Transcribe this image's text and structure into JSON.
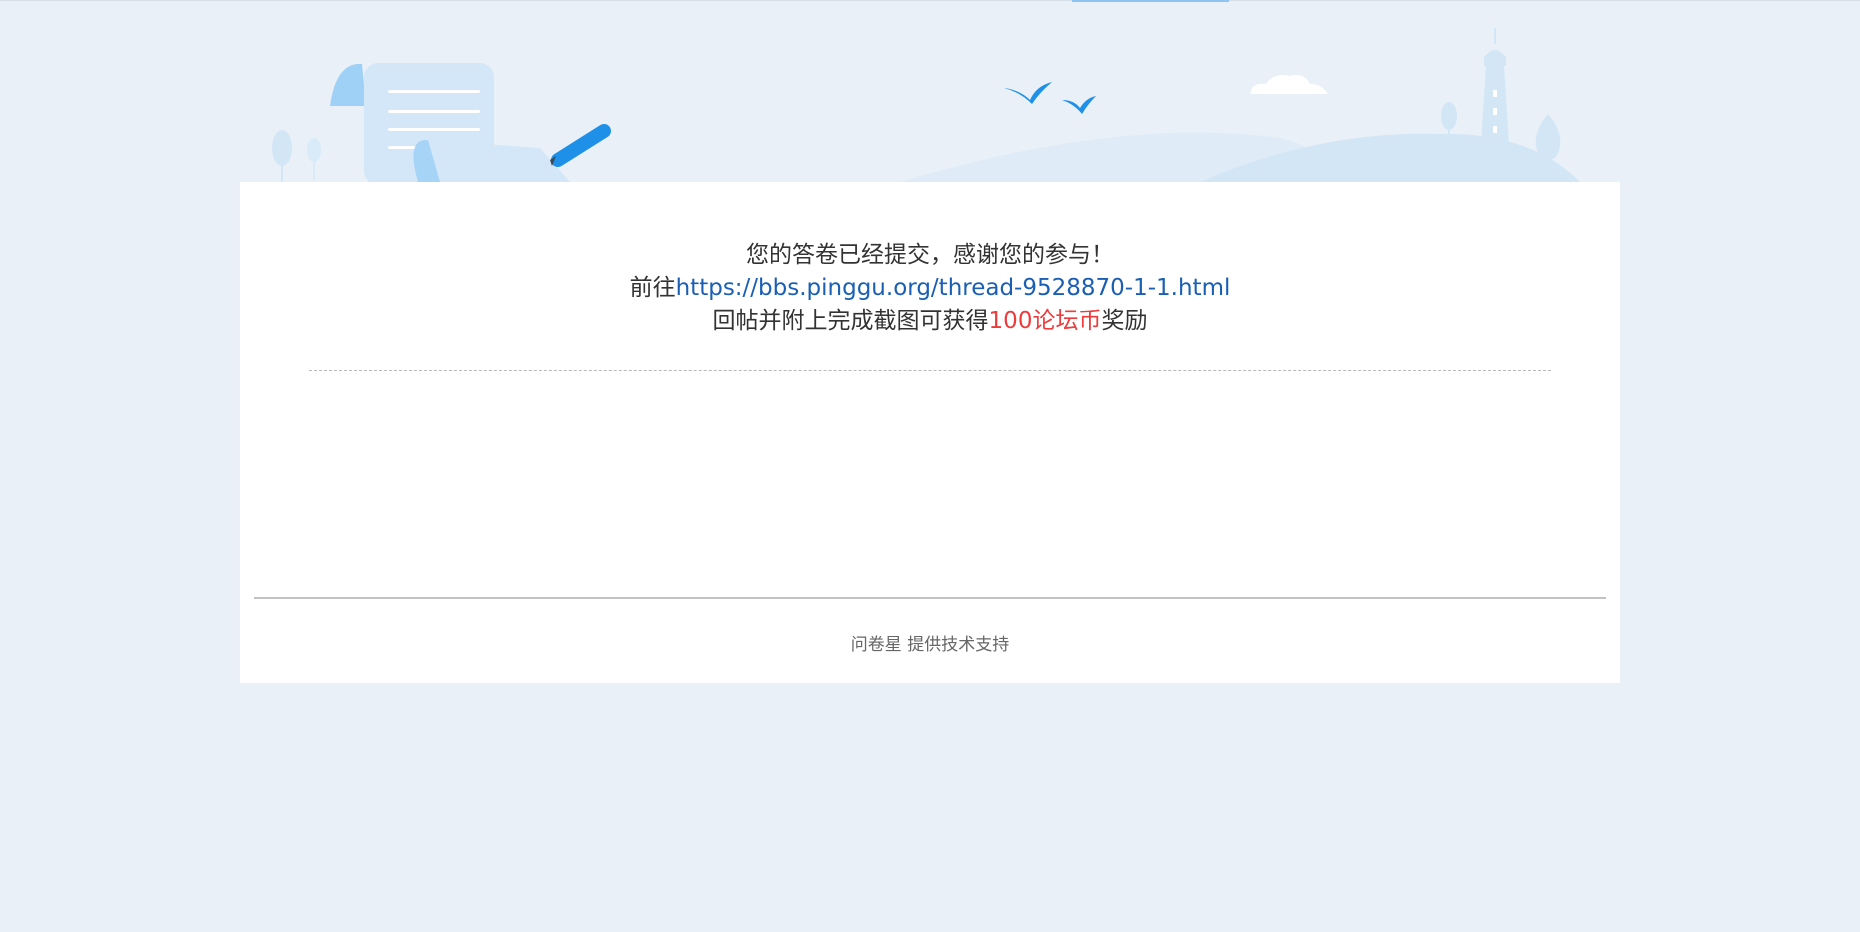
{
  "message": {
    "line1": "您的答卷已经提交，感谢您的参与！",
    "line2_prefix": "前往",
    "link": "https://bbs.pinggu.org/thread-9528870-1-1.html",
    "line3_prefix": "回帖并附上完成截图可获得",
    "reward": "100论坛币",
    "line3_suffix": "奖励"
  },
  "footer": {
    "brand": "问卷星",
    "support": "提供技术支持"
  },
  "colors": {
    "page_background": "#e9f0f8",
    "link": "#1a5fb4",
    "reward": "#ee3b3b",
    "illustration_light": "#d6e8f7",
    "illustration_accent": "#1e90e8"
  }
}
